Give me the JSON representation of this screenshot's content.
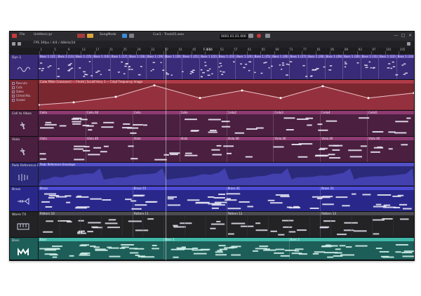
{
  "window": {
    "title": "Untitled.cpr",
    "menu_label": "File",
    "project_info": "FPS 30fps / 4/4 / 48kHz/24",
    "transport_label": "SongMode",
    "center_label": "Cue1 - Track01.wav",
    "position_display": "0001.01.01.000",
    "btn_min": "—",
    "btn_max": "□",
    "btn_close": "×"
  },
  "ruler": {
    "labels": [
      "1",
      "5",
      "9",
      "13",
      "17",
      "21",
      "25",
      "29",
      "33",
      "37",
      "41",
      "45",
      "49",
      "53",
      "57",
      "61",
      "65",
      "69",
      "73",
      "77",
      "81",
      "85",
      "89",
      "93",
      "97",
      "101",
      "105"
    ],
    "center_marker": "F-1-16"
  },
  "colors": {
    "purple": "#3a2b78",
    "purple_strip": "#5a49b3",
    "red": "#7a2730",
    "red_strip": "#b03b48",
    "plum": "#4a1f3f",
    "plum_strip": "#8f3a73",
    "indigo": "#2b2a7a",
    "indigo_strip": "#5350c8",
    "blue": "#29288a",
    "blue_strip": "#4d4bd6",
    "dark": "#232326",
    "dark_strip": "#4b4b50",
    "teal": "#1d5e58",
    "teal_strip": "#3fb8a8",
    "accent": "#e2a33a"
  },
  "tracks": [
    {
      "name": "Dyn 1",
      "icon": "synth-icon",
      "color_key": "purple",
      "clips": [
        "Bass 1 (12)",
        "Bass 1 (13)",
        "Bass 1 (15)",
        "Bass 1 (16)",
        "Bass 1 (17)",
        "Bass 1 (18)",
        "Bass 1 (19)",
        "Bass 1 (20)",
        "Bass 1 (21)",
        "Bass 1 (22)",
        "Bass 1 (23)",
        "Bass 1 (24)",
        "Bass 1 (25)",
        "Bass 1 (26)",
        "Bass 1 (27)",
        "Bass 1 (28)",
        "Bass 1 (29)",
        "Bass 1 (30)",
        "Bass 1 (31)",
        "Bass 1 (32)",
        "Bass 1 (33)"
      ]
    },
    {
      "name": "",
      "icon": "automation-icon",
      "color_key": "red",
      "automation_items": [
        "Revcuts",
        "Cuts",
        "Sides",
        "Ctrled Mix",
        "Snatel"
      ],
      "clips": [
        "Cutw Pitter Crossover) — Fmmt | Sccolf Hary 3 — Cnlpf Frequency Image"
      ]
    },
    {
      "name": "Cell to Vibes",
      "icon": "violin-icon",
      "color_key": "plum",
      "clips": [
        "Cello",
        "Cello 60",
        "Cello",
        "Cello",
        "Cello2",
        "Cello3",
        "Cello4",
        "Cello5"
      ]
    },
    {
      "name": "Viola",
      "icon": "violin-icon",
      "color_key": "plum",
      "clips": [
        "Viola",
        "Viola 46",
        "Viola",
        "Viola",
        "Viola 46",
        "Viola 46",
        "Viola 46",
        "Viola 46"
      ]
    },
    {
      "name": "Pads Reference Dub",
      "icon": "pad-icon",
      "color_key": "indigo",
      "clips": [
        "Pads Reference Envelope"
      ]
    },
    {
      "name": "Brass",
      "icon": "trumpet-icon",
      "color_key": "blue",
      "clips": [
        "Brass",
        "Brass 55",
        "Brass 41",
        "Brass 31"
      ]
    },
    {
      "name": "Warm TX",
      "icon": "keys-icon",
      "color_key": "dark",
      "clips": [
        "Pattern 10",
        "Pattern 11",
        "Pattern 12",
        "Pattern 13"
      ]
    },
    {
      "name": "Bass",
      "icon": "bass-logo-icon",
      "color_key": "teal",
      "clips": [
        "Bass",
        "Bass 1",
        "Bass 2"
      ]
    }
  ]
}
